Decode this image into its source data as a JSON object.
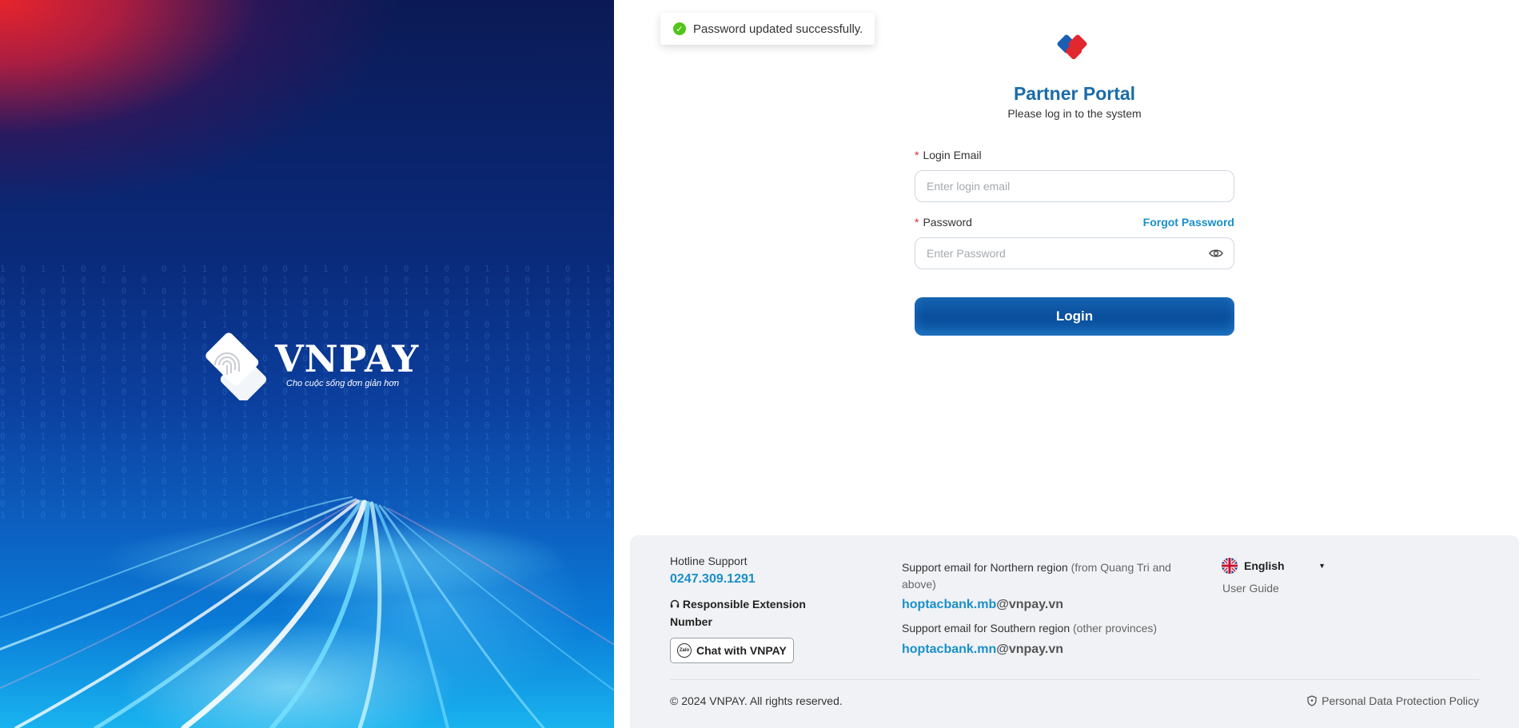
{
  "hero": {
    "brand_name": "VNPAY",
    "slogan": "Cho cuộc sống đơn giản hơn"
  },
  "toast": {
    "message": "Password updated successfully.",
    "icon": "check-circle-icon"
  },
  "login": {
    "title": "Partner Portal",
    "subtitle": "Please log in to the system",
    "email_label": "Login Email",
    "email_placeholder": "Enter login email",
    "email_value": "",
    "password_label": "Password",
    "password_placeholder": "Enter Password",
    "password_value": "",
    "forgot_label": "Forgot Password",
    "submit_label": "Login",
    "required_mark": "*"
  },
  "footer": {
    "hotline_title": "Hotline Support",
    "hotline_number": "0247.309.1291",
    "extension_label": "Responsible Extension Number",
    "chat_label": "Chat with VNPAY",
    "chat_icon_text": "Zalo",
    "north_label": "Support email for Northern region",
    "north_note": "(from Quang Tri and above)",
    "north_email_user": "hoptacbank.mb",
    "north_email_domain": "@vnpay.vn",
    "south_label": "Support email for Southern region",
    "south_note": "(other provinces)",
    "south_email_user": "hoptacbank.mn",
    "south_email_domain": "@vnpay.vn",
    "language": "English",
    "user_guide": "User Guide",
    "copyright": "© 2024 VNPAY. All rights reserved.",
    "privacy_policy": "Personal Data Protection Policy"
  },
  "colors": {
    "primary": "#0a4f9e",
    "title_blue": "#1a6ba8",
    "link_blue": "#1a8fc9",
    "required_red": "#e0282e",
    "success_green": "#52c41a"
  }
}
